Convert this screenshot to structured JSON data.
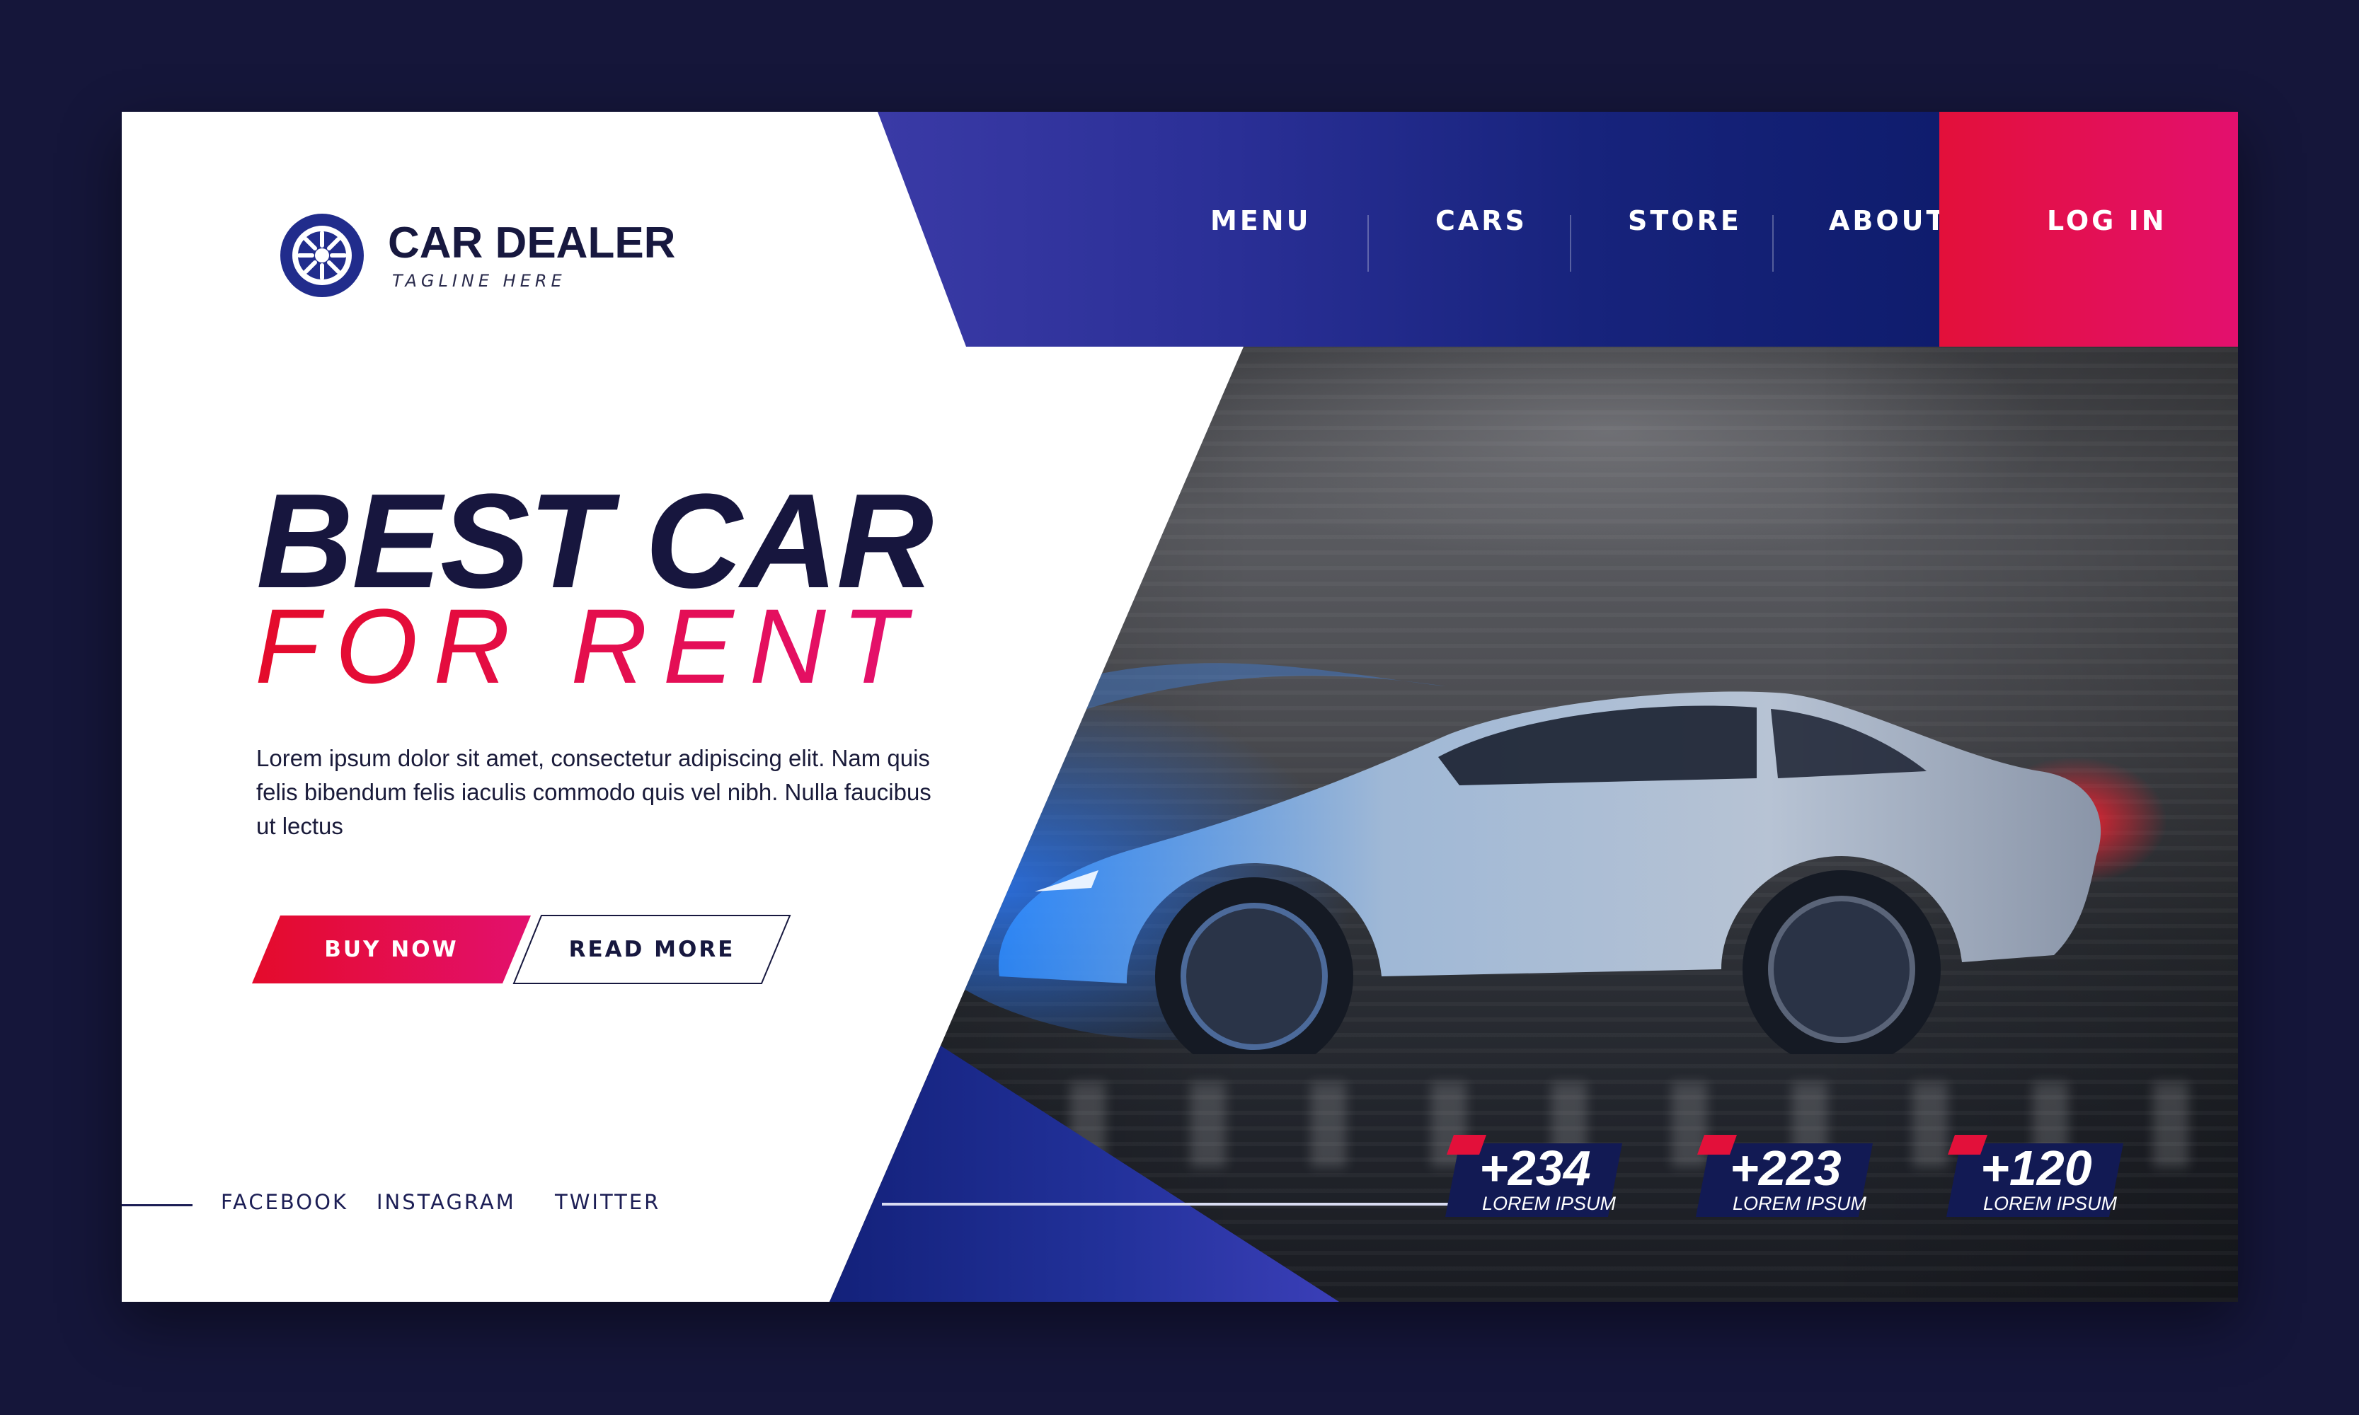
{
  "brand": {
    "name": "CAR DEALER",
    "tagline": "TAGLINE HERE",
    "logo_icon": "wheel-icon"
  },
  "nav": {
    "items": [
      "MENU",
      "CARS",
      "STORE",
      "ABOUT US"
    ],
    "login_label": "LOG IN"
  },
  "hero": {
    "title_line1": "BEST CAR",
    "title_line2": "FOR RENT",
    "description": "Lorem ipsum dolor sit amet, consectetur adipiscing elit. Nam quis felis bibendum felis iaculis commodo quis vel nibh. Nulla faucibus ut lectus",
    "buy_label": "BUY NOW",
    "read_label": "READ MORE",
    "image": "sports-car-motion-photo"
  },
  "social": {
    "items": [
      "FACEBOOK",
      "INSTAGRAM",
      "TWITTER"
    ]
  },
  "stats": [
    {
      "value": "+234",
      "label": "LOREM IPSUM"
    },
    {
      "value": "+223",
      "label": "LOREM IPSUM"
    },
    {
      "value": "+120",
      "label": "LOREM IPSUM"
    }
  ],
  "colors": {
    "page_background": "#15163a",
    "navy": "#17183f",
    "nav_blue": "#1c2a88",
    "accent_red": "#e3103a",
    "accent_pink": "#e3106e"
  }
}
